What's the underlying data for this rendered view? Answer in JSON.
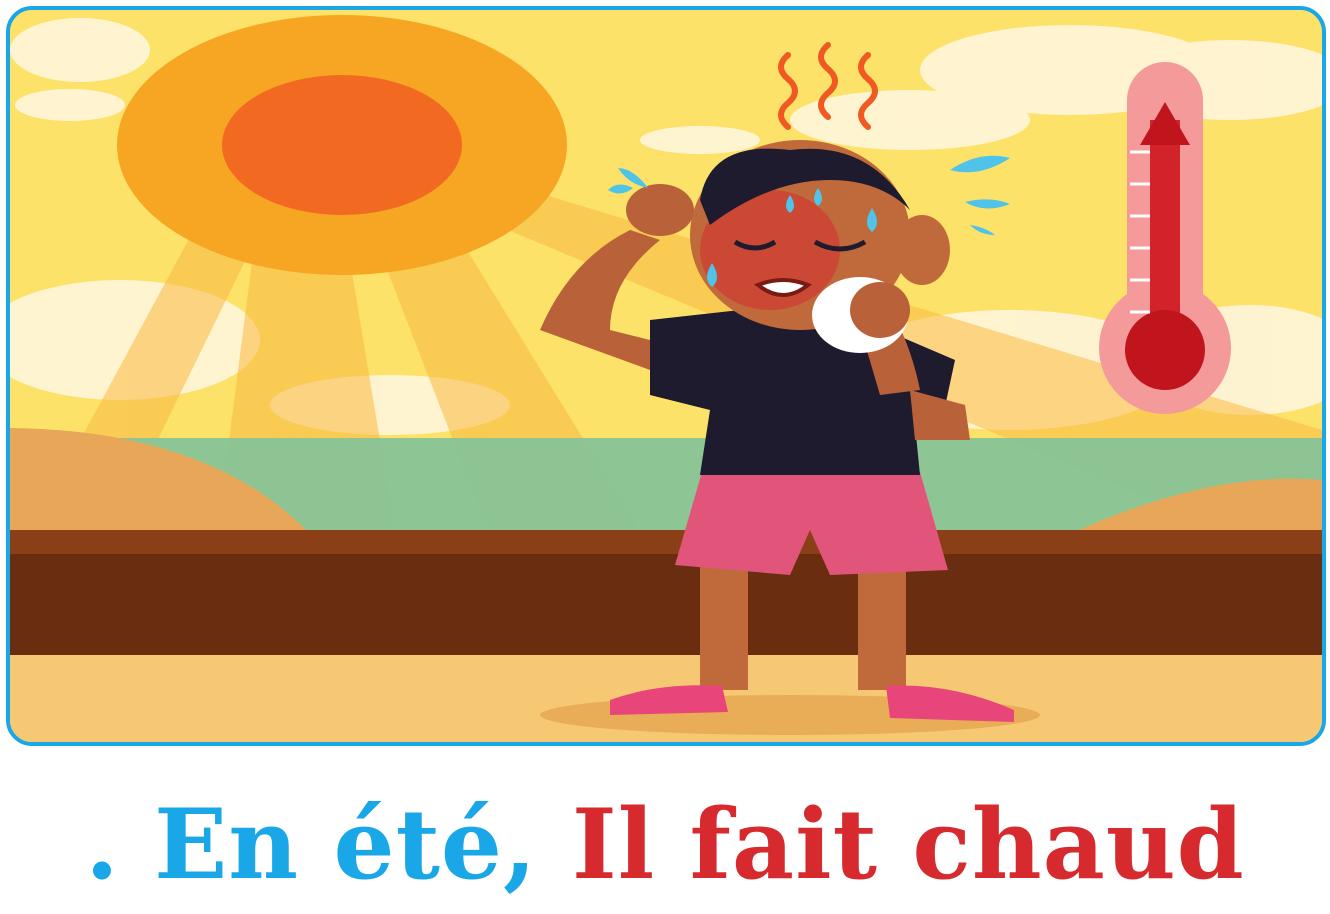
{
  "illustration": {
    "subject": "summer-heat-scene",
    "icons": [
      "sun-icon",
      "thermometer-icon",
      "heat-waves-icon",
      "sweat-drops-icon",
      "boy-figure",
      "cloud-icon"
    ],
    "colors": {
      "frame_border": "#1aa7e8",
      "sky": "#fde26a",
      "sun_outer": "#f6a623",
      "sun_inner": "#f26a22",
      "sea": "#82c29a",
      "ground": "#6b2d10",
      "sand": "#f7c873",
      "shirt": "#1f1b2e",
      "shorts": "#e2557a",
      "thermometer": "#e23030"
    }
  },
  "caption": {
    "part_a": ". En été,",
    "part_b": "Il fait chaud",
    "color_a": "#1aa7e8",
    "color_b": "#d62a2e"
  }
}
